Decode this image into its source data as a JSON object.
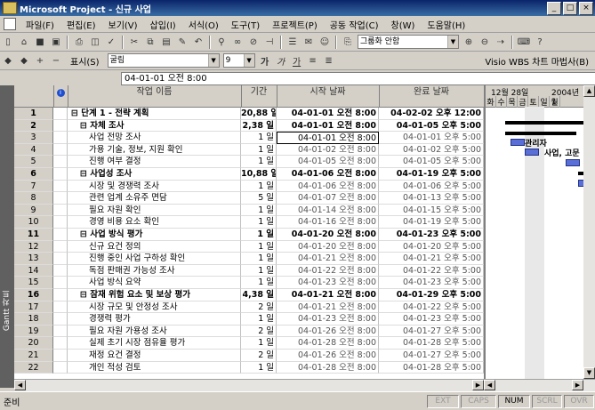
{
  "window": {
    "title": "Microsoft Project - 신규 사업",
    "min": "_",
    "max": "□",
    "close": "×"
  },
  "menu": [
    "파일(F)",
    "편집(E)",
    "보기(V)",
    "삽입(I)",
    "서식(O)",
    "도구(T)",
    "프로젝트(P)",
    "공동 작업(C)",
    "창(W)",
    "도움말(H)"
  ],
  "toolbar": {
    "group_select": "그룹화 안함",
    "show_label": "표시(S)",
    "font": "굴림",
    "font_size": "9",
    "bold": "가",
    "italic": "가",
    "underline": "가",
    "visio_label": "Visio WBS 차트 마법사(B)"
  },
  "entry": {
    "value": "04-01-01 오전 8:00"
  },
  "view": {
    "label": "Gantt 차트"
  },
  "columns": {
    "name": "작업 이름",
    "duration": "기간",
    "start": "시작 날짜",
    "finish": "완료 날짜"
  },
  "rows": [
    {
      "id": "1",
      "name": "⊟ 단계 1 - 전략 계획",
      "dur": "20,88 일",
      "start": "04-01-01 오전 8:00",
      "fin": "04-02-02 오후 12:00",
      "bold": true,
      "indent": 0
    },
    {
      "id": "2",
      "name": "⊟ 자체 조사",
      "dur": "2,38 일",
      "start": "04-01-01 오전 8:00",
      "fin": "04-01-05 오후 5:00",
      "bold": true,
      "indent": 1
    },
    {
      "id": "3",
      "name": "사업 전망 조사",
      "dur": "1 일",
      "start": "04-01-01 오전 8:00",
      "fin": "04-01-01 오후 5:00",
      "bold": false,
      "indent": 2
    },
    {
      "id": "4",
      "name": "가용 기술, 정보, 지원 확인",
      "dur": "1 일",
      "start": "04-01-02 오전 8:00",
      "fin": "04-01-02 오후 5:00",
      "bold": false,
      "indent": 2
    },
    {
      "id": "5",
      "name": "진행 여부 결정",
      "dur": "1 일",
      "start": "04-01-05 오전 8:00",
      "fin": "04-01-05 오후 5:00",
      "bold": false,
      "indent": 2
    },
    {
      "id": "6",
      "name": "⊟ 사업성 조사",
      "dur": "10,88 일",
      "start": "04-01-06 오전 8:00",
      "fin": "04-01-19 오후 5:00",
      "bold": true,
      "indent": 1
    },
    {
      "id": "7",
      "name": "시장 및 경쟁력 조사",
      "dur": "1 일",
      "start": "04-01-06 오전 8:00",
      "fin": "04-01-06 오후 5:00",
      "bold": false,
      "indent": 2
    },
    {
      "id": "8",
      "name": "관련 업계 소유주 면담",
      "dur": "5 일",
      "start": "04-01-07 오전 8:00",
      "fin": "04-01-13 오후 5:00",
      "bold": false,
      "indent": 2
    },
    {
      "id": "9",
      "name": "필요 자원 확인",
      "dur": "1 일",
      "start": "04-01-14 오전 8:00",
      "fin": "04-01-15 오후 5:00",
      "bold": false,
      "indent": 2
    },
    {
      "id": "10",
      "name": "경영 비용 요소 확인",
      "dur": "1 일",
      "start": "04-01-16 오전 8:00",
      "fin": "04-01-19 오후 5:00",
      "bold": false,
      "indent": 2
    },
    {
      "id": "11",
      "name": "⊟ 사업 방식 평가",
      "dur": "1 일",
      "start": "04-01-20 오전 8:00",
      "fin": "04-01-23 오후 5:00",
      "bold": true,
      "indent": 1
    },
    {
      "id": "12",
      "name": "신규 요건 정의",
      "dur": "1 일",
      "start": "04-01-20 오전 8:00",
      "fin": "04-01-20 오후 5:00",
      "bold": false,
      "indent": 2
    },
    {
      "id": "13",
      "name": "진행 중인 사업 구하성 확인",
      "dur": "1 일",
      "start": "04-01-21 오전 8:00",
      "fin": "04-01-21 오후 5:00",
      "bold": false,
      "indent": 2
    },
    {
      "id": "14",
      "name": "독점 판매권 가능성 조사",
      "dur": "1 일",
      "start": "04-01-22 오전 8:00",
      "fin": "04-01-22 오후 5:00",
      "bold": false,
      "indent": 2
    },
    {
      "id": "15",
      "name": "사업 방식 요약",
      "dur": "1 일",
      "start": "04-01-23 오전 8:00",
      "fin": "04-01-23 오후 5:00",
      "bold": false,
      "indent": 2
    },
    {
      "id": "16",
      "name": "⊟ 잠재 위험 요소 및 보상 평가",
      "dur": "4,38 일",
      "start": "04-01-21 오전 8:00",
      "fin": "04-01-29 오후 5:00",
      "bold": true,
      "indent": 1
    },
    {
      "id": "17",
      "name": "시장 규모 및 안정성 조사",
      "dur": "2 일",
      "start": "04-01-21 오전 8:00",
      "fin": "04-01-22 오후 5:00",
      "bold": false,
      "indent": 2
    },
    {
      "id": "18",
      "name": "경쟁력 평가",
      "dur": "1 일",
      "start": "04-01-23 오전 8:00",
      "fin": "04-01-23 오후 5:00",
      "bold": false,
      "indent": 2
    },
    {
      "id": "19",
      "name": "필요 자원 가용성 조사",
      "dur": "2 일",
      "start": "04-01-26 오전 8:00",
      "fin": "04-01-27 오후 5:00",
      "bold": false,
      "indent": 2
    },
    {
      "id": "20",
      "name": "실제 초기 시장 점유율 평가",
      "dur": "1 일",
      "start": "04-01-28 오전 8:00",
      "fin": "04-01-28 오후 5:00",
      "bold": false,
      "indent": 2
    },
    {
      "id": "21",
      "name": "재정 요건 결정",
      "dur": "2 일",
      "start": "04-01-26 오전 8:00",
      "fin": "04-01-27 오후 5:00",
      "bold": false,
      "indent": 2
    },
    {
      "id": "22",
      "name": "개인 적성 검토",
      "dur": "1 일",
      "start": "04-01-28 오전 8:00",
      "fin": "04-01-28 오후 5:00",
      "bold": false,
      "indent": 2
    }
  ],
  "gantt": {
    "header_left": "12월 28일",
    "header_right": "2004년 1",
    "days": [
      "화",
      "수",
      "목",
      "금",
      "토",
      "일",
      "월"
    ],
    "label_1": "관리자",
    "label_2": "사업, 고문"
  },
  "status": {
    "ready": "준비",
    "ext": "EXT",
    "caps": "CAPS",
    "num": "NUM",
    "scrl": "SCRL",
    "ovr": "OVR"
  }
}
